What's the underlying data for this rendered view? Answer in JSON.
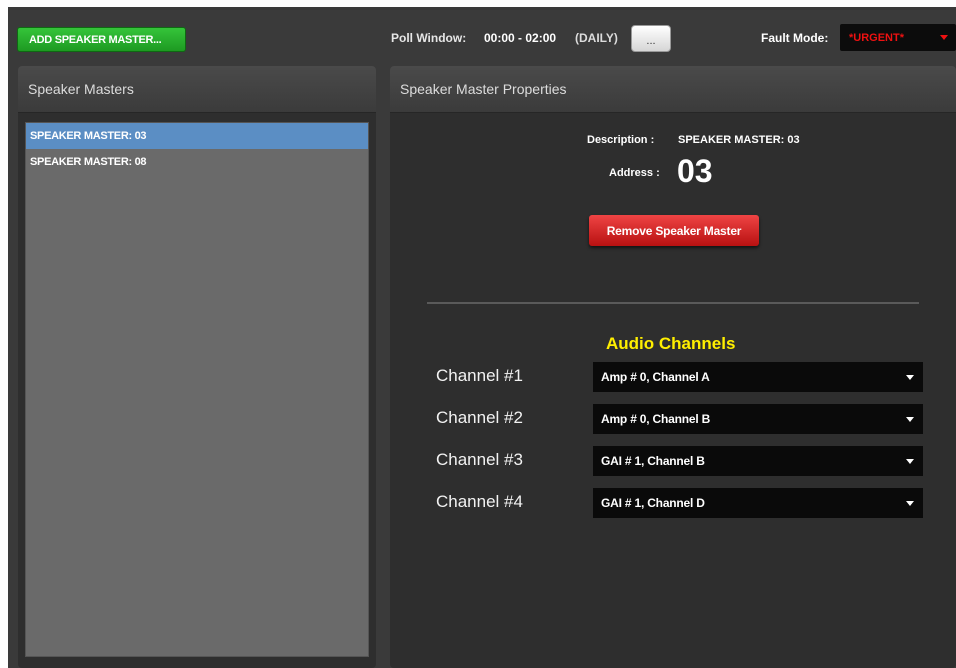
{
  "toolbar": {
    "add_button": "ADD SPEAKER MASTER...",
    "poll_window_label": "Poll Window:",
    "poll_window_value": "00:00 - 02:00",
    "poll_window_mode": "(DAILY)",
    "poll_button": "...",
    "fault_mode_label": "Fault Mode:",
    "fault_mode_value": "*URGENT*"
  },
  "left_panel": {
    "title": "Speaker Masters",
    "items": [
      "SPEAKER MASTER: 03",
      "SPEAKER MASTER: 08"
    ],
    "selected_index": 0
  },
  "right_panel": {
    "title": "Speaker Master Properties",
    "description_label": "Description :",
    "description_value": "SPEAKER MASTER: 03",
    "address_label": "Address :",
    "address_value": "03",
    "remove_button": "Remove Speaker Master",
    "audio_channels_title": "Audio Channels",
    "channels": [
      {
        "label": "Channel #1",
        "value": "Amp # 0, Channel A"
      },
      {
        "label": "Channel #2",
        "value": "Amp # 0, Channel B"
      },
      {
        "label": "Channel #3",
        "value": "GAI # 1, Channel B"
      },
      {
        "label": "Channel #4",
        "value": "GAI # 1, Channel D"
      }
    ]
  },
  "colors": {
    "background": "#3a3a3a",
    "add_button": "#2db532",
    "remove_button": "#d42020",
    "selection": "#5b8ec4",
    "section_title": "#ffef00",
    "fault_text": "#ee1111"
  }
}
